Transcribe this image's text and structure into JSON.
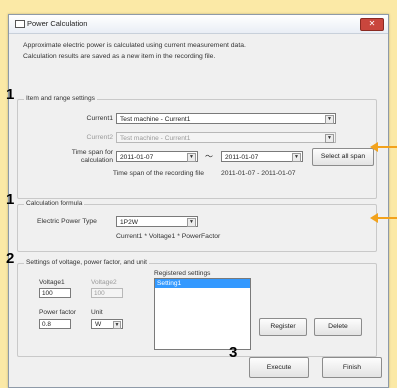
{
  "window": {
    "title": "Power Calculation",
    "close_symbol": "✕"
  },
  "description": {
    "line1": "Approximate electric power is calculated using current measurement data.",
    "line2": "Calculation results are saved as a new item in the recording file."
  },
  "markers": {
    "m1": "1",
    "m2": "1",
    "m3": "2",
    "m4": "3"
  },
  "item_range": {
    "label": "Item and range settings",
    "current1_label": "Current1",
    "current1_value": "Test machine - Current1",
    "current2_label": "Current2",
    "current2_value": "Test machine - Current1",
    "timespan_label": "Time span for calculation",
    "start_date": "2011-01-07",
    "tilde": "～",
    "end_date": "2011-01-07",
    "select_all_label": "Select all span",
    "recording_label": "Time span of the recording file",
    "recording_value": "2011-01-07 - 2011-01-07"
  },
  "calc_formula": {
    "label": "Calculation formula",
    "type_label": "Electric Power Type",
    "type_value": "1P2W",
    "formula": "Current1 * Voltage1 * PowerFactor"
  },
  "settings": {
    "label": "Settings of voltage, power factor, and unit",
    "voltage1_label": "Voltage1",
    "voltage1_value": "100",
    "voltage2_label": "Voltage2",
    "voltage2_value": "100",
    "pf_label": "Power factor",
    "pf_value": "0.8",
    "unit_label": "Unit",
    "unit_value": "W",
    "registered_label": "Registered settings",
    "registered_items": [
      "Setting1"
    ],
    "register_label": "Register",
    "delete_label": "Delete"
  },
  "footer": {
    "execute_label": "Execute",
    "finish_label": "Finish"
  },
  "colors": {
    "annotation_arrow": "#f2a21c",
    "selection": "#3399ff",
    "background": "#fbe9a6"
  }
}
